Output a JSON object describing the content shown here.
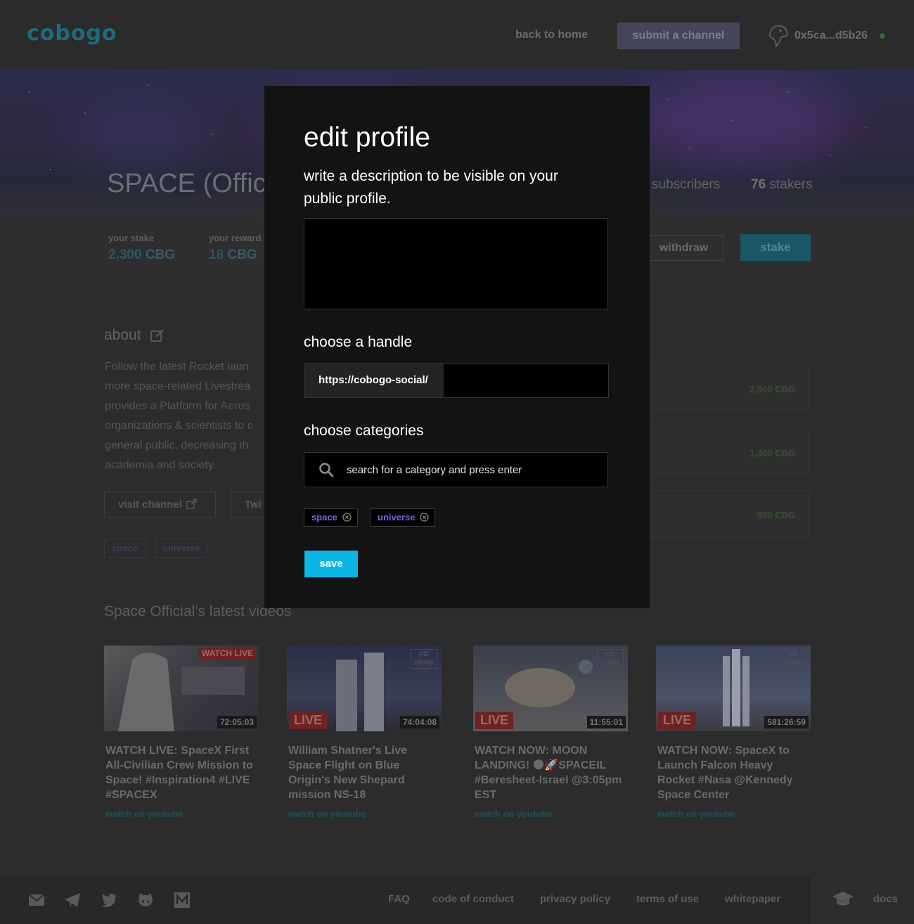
{
  "header": {
    "logo": "cobogo",
    "nav_home": "back to home",
    "nav_submit": "submit a channel",
    "wallet_address": "0x5ca...d5b26"
  },
  "channel": {
    "title": "SPACE (Offici",
    "subscribers_label": "subscribers",
    "stakers_count": "76",
    "stakers_label": "stakers"
  },
  "stake": {
    "your_stake_label": "your stake",
    "your_stake_value": "2,300",
    "your_stake_unit": "CBG",
    "your_rewards_label": "your reward",
    "your_rewards_value": "18",
    "your_rewards_unit": "CBG",
    "withdraw_label": "withdraw",
    "stake_label": "stake"
  },
  "about": {
    "heading": "about",
    "text": "Follow the latest Rocket laun\nmore space-related Livestrea\nprovides a Platform for Aeros\norganizations & scientists to c\ngeneral public, decreasing th\nacademia and society.",
    "visit_label": "visit channel",
    "twitter_label": "Twi",
    "tags": [
      "space",
      "universe"
    ]
  },
  "stakers_list": [
    "2,000 CBG",
    "1,300 CBG",
    "800 CBG"
  ],
  "videos": {
    "heading": "Space Official’s latest videos",
    "items": [
      {
        "title": "WATCH LIVE: SpaceX First All-Civilian Crew Mission to Space! #Inspiration4 #LIVE #SPACEX",
        "duration": "72:05:03",
        "badge": "WATCH LIVE",
        "link": "watch on youtube"
      },
      {
        "title": "William Shatner's Live Space Flight on Blue Origin's New Shepard mission NS-18",
        "duration": "74:04:08",
        "badge": "LIVE",
        "link": "watch on youtube"
      },
      {
        "title": "WATCH NOW: MOON LANDING! 🌑🚀SPACEIL #Beresheet-Israel @3:05pm EST",
        "duration": "11:55:01",
        "badge": "LIVE",
        "link": "watch on youtube"
      },
      {
        "title": "WATCH NOW: SpaceX to Launch Falcon Heavy Rocket #Nasa @Kennedy Space Center",
        "duration": "581:26:59",
        "badge": "LIVE",
        "link": "watch on youtube"
      }
    ]
  },
  "footer": {
    "links": [
      "FAQ",
      "code of conduct",
      "privacy policy",
      "terms of use",
      "whitepaper"
    ],
    "docs_label": "docs"
  },
  "modal": {
    "title": "edit profile",
    "description": "write a description to be visible on your public profile.",
    "description_value": "",
    "handle_heading": "choose a handle",
    "handle_prefix": "https://cobogo-social/",
    "handle_value": "",
    "categories_heading": "choose categories",
    "search_placeholder": "search for a category and press enter",
    "selected_tags": [
      "space",
      "universe"
    ],
    "save_label": "save"
  },
  "colors": {
    "accent": "#0bb4e4",
    "tag_text": "#7268f0",
    "modal_bg": "#131313"
  }
}
